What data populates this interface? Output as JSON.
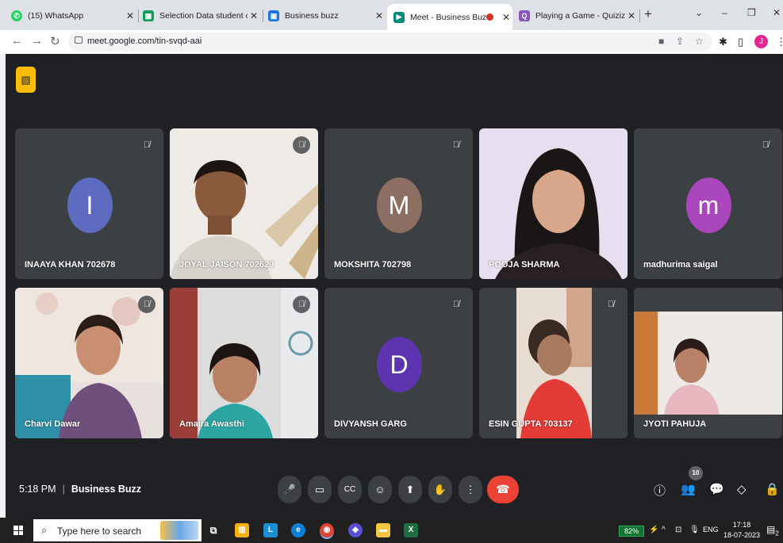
{
  "browser": {
    "tabs": [
      {
        "title": "(15) WhatsApp",
        "icon": "whatsapp-icon",
        "color": "#25d366"
      },
      {
        "title": "Selection Data student council",
        "icon": "sheets-icon",
        "color": "#0f9d58"
      },
      {
        "title": "Business buzz",
        "icon": "classroom-icon",
        "color": "#1a73e8"
      },
      {
        "title": "Meet - Business Buzz",
        "icon": "meet-icon",
        "color": "#00897b"
      },
      {
        "title": "Playing a Game - Quizizz",
        "icon": "quizizz-icon",
        "color": "#8854c0"
      }
    ],
    "url": "meet.google.com/tin-svqd-aai",
    "new_tab": "+",
    "profile_initial": "J"
  },
  "meet": {
    "participants": [
      {
        "name": "INAAYA KHAN 702678",
        "letter": "I",
        "color": "#5c6bc0",
        "video": false,
        "muted": true
      },
      {
        "name": "JOYAL JAISON 702629",
        "letter": "",
        "color": "",
        "video": true,
        "muted": true
      },
      {
        "name": "MOKSHITA 702798",
        "letter": "M",
        "color": "#8d6e63",
        "video": false,
        "muted": true
      },
      {
        "name": "POOJA SHARMA",
        "letter": "",
        "color": "",
        "video": true,
        "muted": false
      },
      {
        "name": "madhurima saigal",
        "letter": "m",
        "color": "#ab47bc",
        "video": false,
        "muted": true
      },
      {
        "name": "Charvi Dawar",
        "letter": "",
        "color": "",
        "video": true,
        "muted": true
      },
      {
        "name": "Amaira Awasthi",
        "letter": "",
        "color": "",
        "video": true,
        "muted": true
      },
      {
        "name": "DIVYANSH GARG",
        "letter": "D",
        "color": "#5e35b1",
        "video": false,
        "muted": true
      },
      {
        "name": "ESIN GUPTA 703137",
        "letter": "",
        "color": "",
        "video": true,
        "muted": true
      },
      {
        "name": "JYOTI PAHUJA",
        "letter": "",
        "color": "",
        "video": true,
        "muted": false
      }
    ],
    "time": "5:18 PM",
    "meeting_name": "Business Buzz",
    "participant_count": "10",
    "accent_end_call": "#ea4335"
  },
  "taskbar": {
    "search_placeholder": "Type here to search",
    "battery": "82%",
    "language": "ENG",
    "time": "17:18",
    "date": "18-07-2023",
    "notification_count": "2"
  }
}
